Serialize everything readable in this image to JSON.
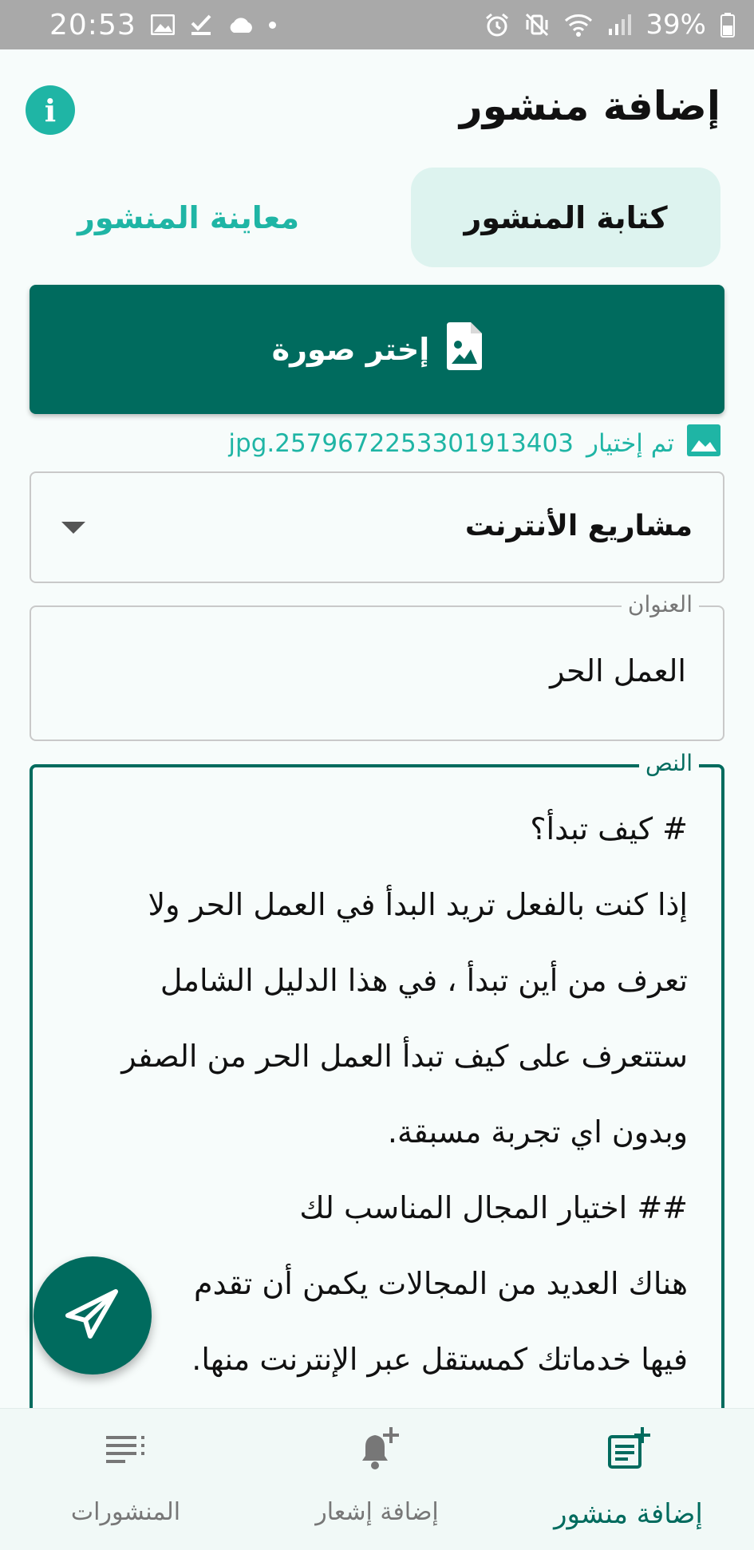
{
  "status_bar": {
    "time": "20:53",
    "battery": "39%",
    "left_icons": [
      "image-icon",
      "check-icon",
      "cloud-icon",
      "dot-icon"
    ],
    "right_icons": [
      "alarm-icon",
      "vibrate-off-icon",
      "wifi-icon",
      "signal-icon",
      "battery-icon"
    ]
  },
  "header": {
    "title": "إضافة منشور",
    "info_icon": "info-icon"
  },
  "tabs": {
    "write": "كتابة المنشور",
    "preview": "معاينة المنشور"
  },
  "image_picker": {
    "button_label": "إختر صورة",
    "selected_label": "تم إختيار",
    "file_name": "2579672253301913403.jpg"
  },
  "category": {
    "selected": "مشاريع الأنترنت"
  },
  "title_field": {
    "label": "العنوان",
    "value": "العمل الحر"
  },
  "body_field": {
    "label": "النص",
    "value": "#  كيف تبدأ؟\nإذا كنت بالفعل تريد البدأ في العمل الحر ولا\nتعرف من أين تبدأ ، في هذا الدليل الشامل\nستتعرف على كيف تبدأ العمل الحر من الصفر\nوبدون اي تجربة مسبقة.\n## اختيار المجال المناسب لك\nهناك العديد من المجالات يكمن أن تقدم\nفيها خدماتك كمستقل عبر الإنترنت منها."
  },
  "bottom_nav": {
    "items": [
      {
        "label": "إضافة منشور",
        "icon": "add-post-icon",
        "active": true
      },
      {
        "label": "إضافة إشعار",
        "icon": "add-notification-icon",
        "active": false
      },
      {
        "label": "المنشورات",
        "icon": "posts-list-icon",
        "active": false
      }
    ]
  },
  "colors": {
    "primary": "#006b5e",
    "accent": "#1fb5a5",
    "tab_active_bg": "#ddf3ef",
    "status_bar": "#a9a9a9"
  }
}
